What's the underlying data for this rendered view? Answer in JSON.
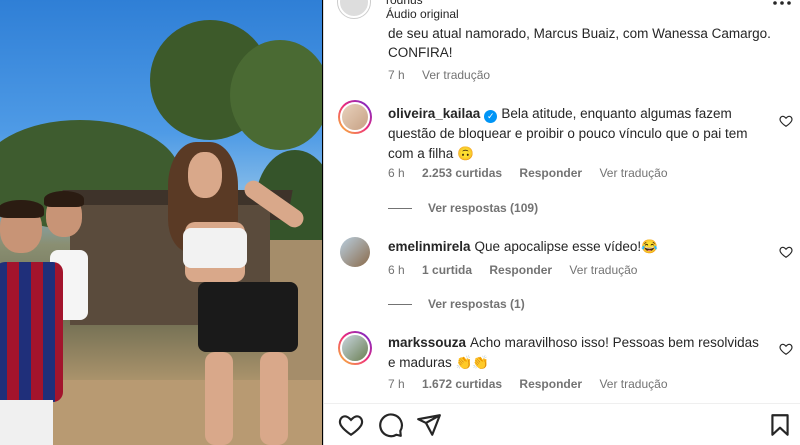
{
  "header": {
    "username": "rodrius",
    "audio_label": "Áudio original",
    "more_icon": "more-icon"
  },
  "caption": {
    "text": "de seu atual namorado, Marcus Buaiz, com Wanessa Camargo. CONFIRA!",
    "time": "7 h",
    "translate": "Ver tradução"
  },
  "comments": [
    {
      "username": "oliveira_kailaa",
      "verified": true,
      "text": "Bela atitude, enquanto algumas fazem questão de bloquear e proibir o pouco vínculo que o pai tem com a filha 🙃",
      "time": "6 h",
      "likes": "2.253 curtidas",
      "reply": "Responder",
      "translate": "Ver tradução",
      "view_replies": "Ver respostas (109)"
    },
    {
      "username": "emelinmirela",
      "verified": false,
      "text": "Que apocalipse esse vídeo!😂",
      "time": "6 h",
      "likes": "1 curtida",
      "reply": "Responder",
      "translate": "Ver tradução",
      "view_replies": "Ver respostas (1)"
    },
    {
      "username": "markssouza",
      "verified": false,
      "text": "Acho maravilhoso isso! Pessoas bem resolvidas e maduras 👏👏",
      "time": "7 h",
      "likes": "1.672 curtidas",
      "reply": "Responder",
      "translate": "Ver tradução"
    }
  ],
  "actions": {
    "icons": [
      "heart-icon",
      "comment-icon",
      "share-icon",
      "bookmark-icon"
    ]
  },
  "colors": {
    "text": "#262626",
    "secondary": "#737373",
    "verified": "#0095f6"
  }
}
